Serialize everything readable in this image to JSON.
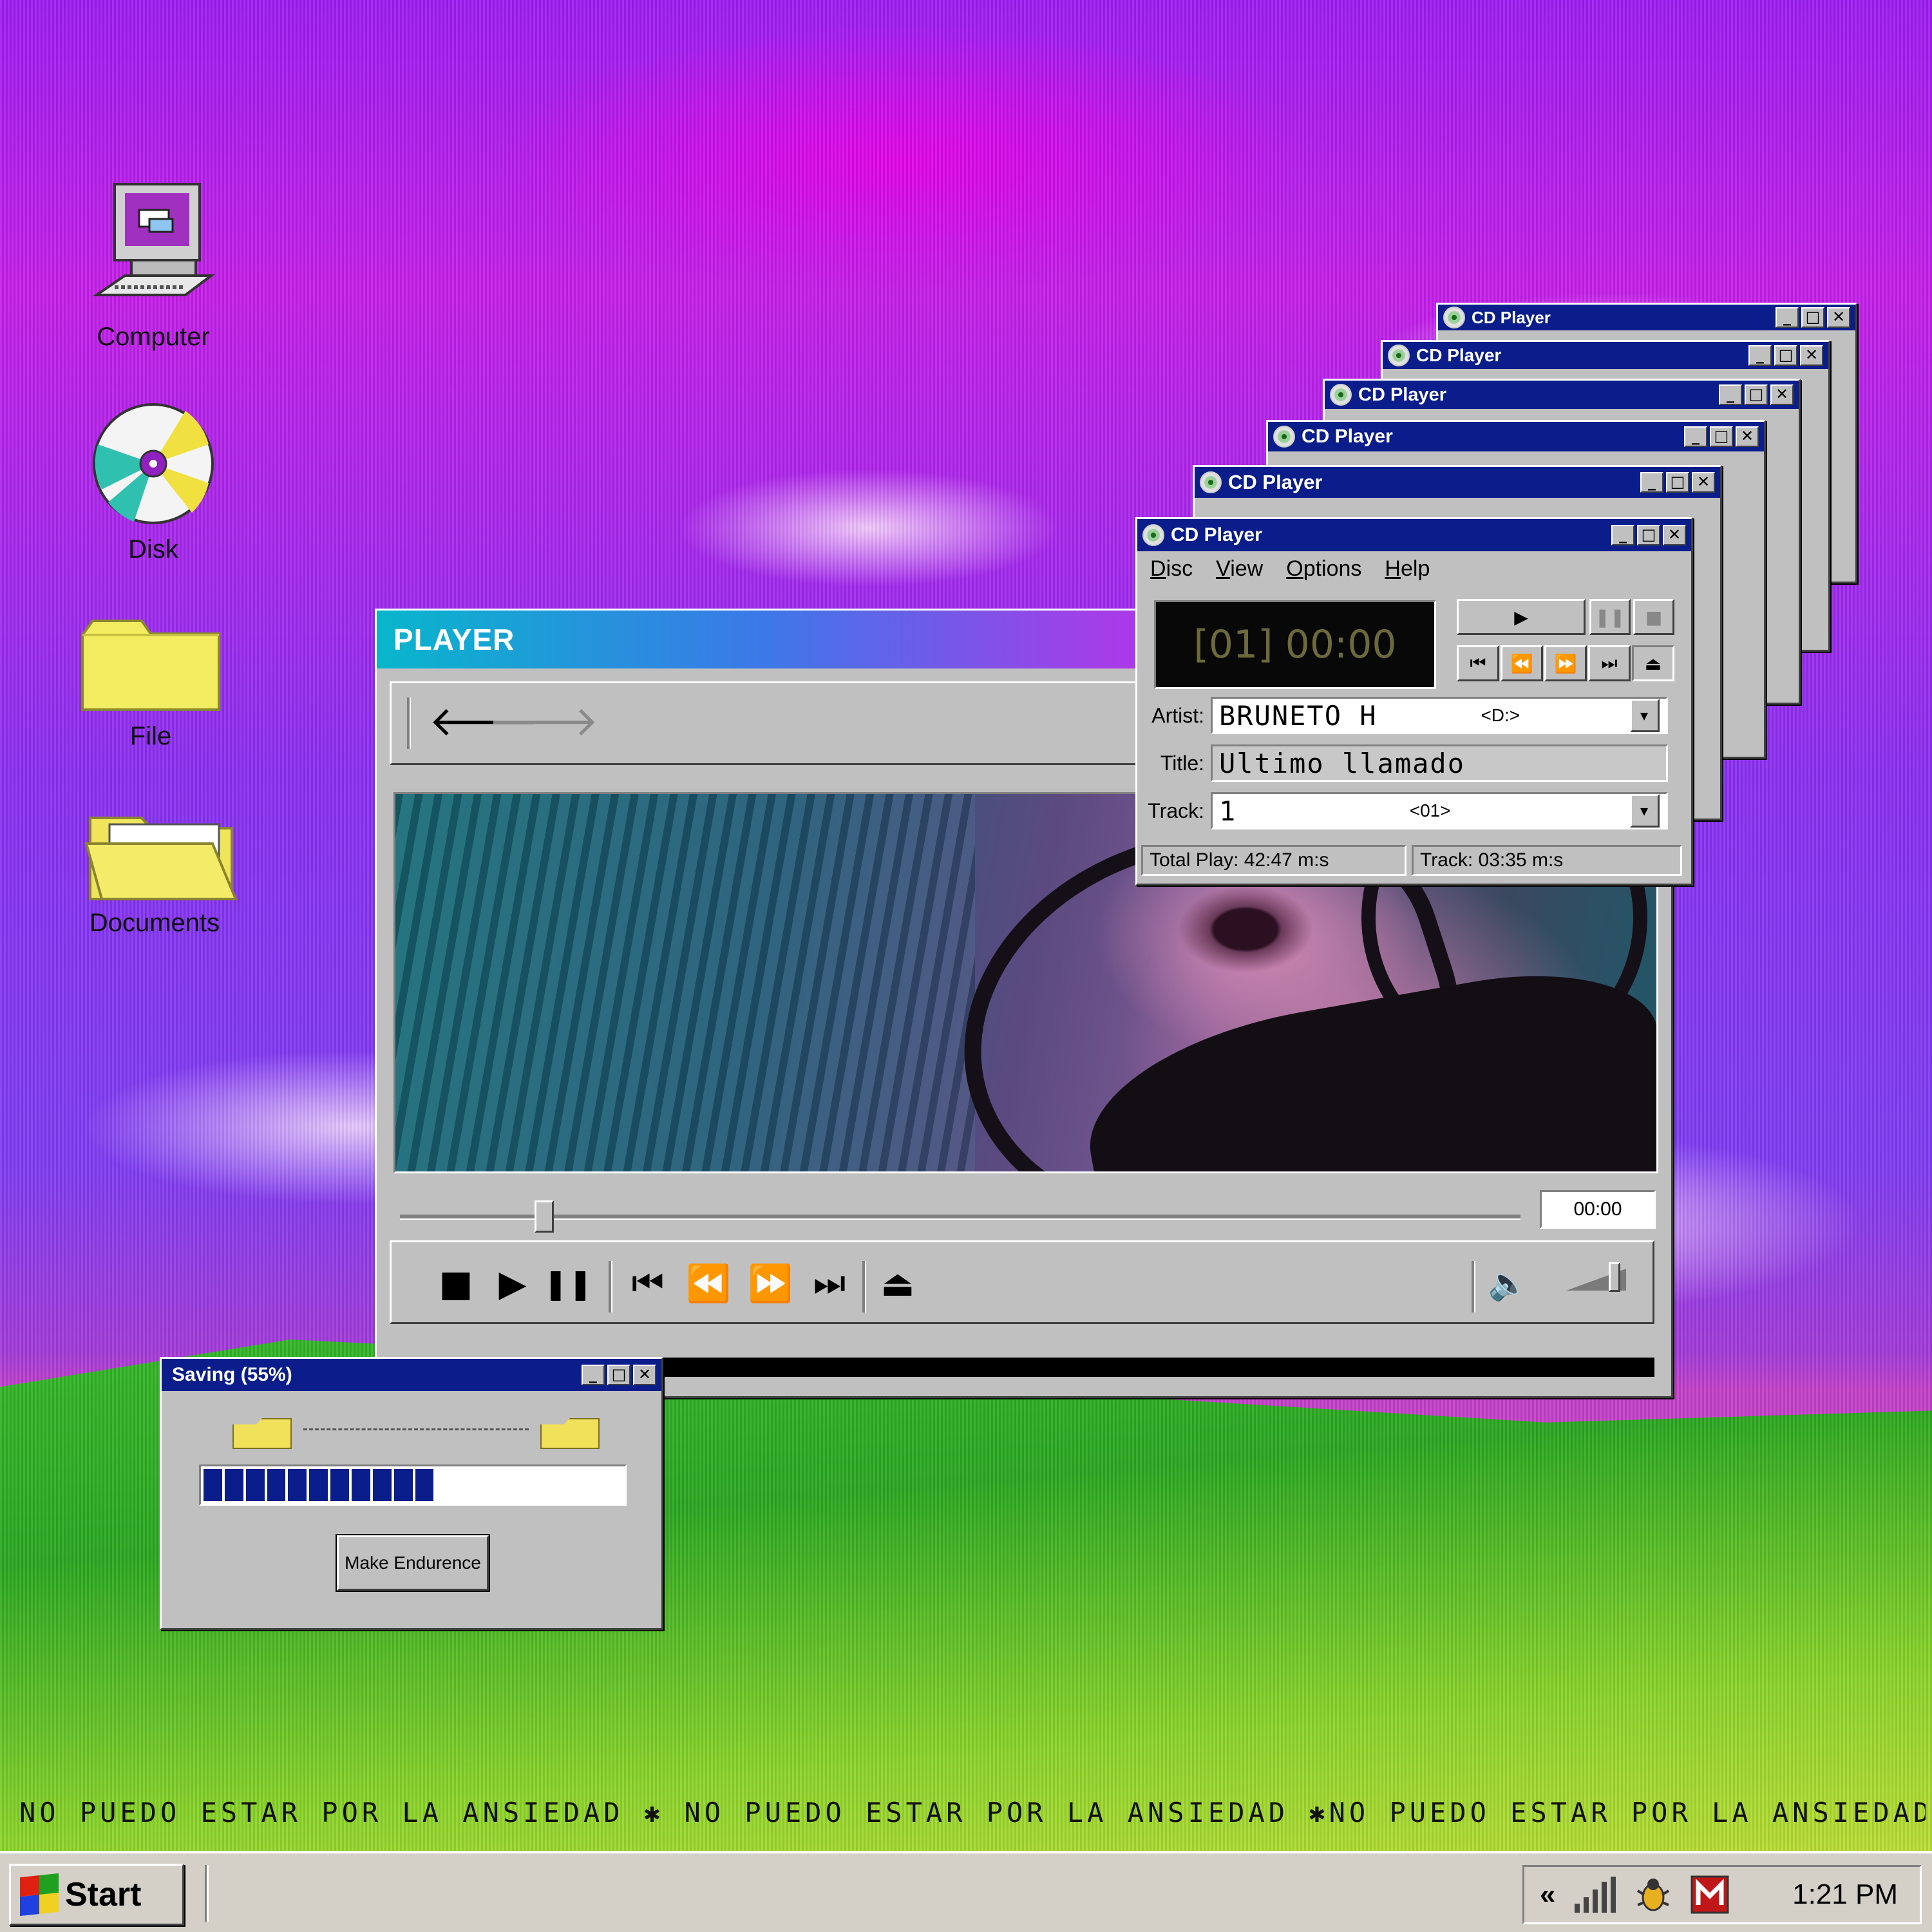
{
  "desktop": {
    "icons": [
      {
        "label": "Computer",
        "icon": "computer-icon"
      },
      {
        "label": "Disk",
        "icon": "cd-disk-icon"
      },
      {
        "label": "File",
        "icon": "folder-icon"
      },
      {
        "label": "Documents",
        "icon": "open-folder-icon"
      }
    ]
  },
  "cd_stack": {
    "titles": [
      "CD Player",
      "CD Player",
      "CD Player",
      "CD Player",
      "CD Player"
    ]
  },
  "cd_player": {
    "title": "CD Player",
    "menu": [
      "Disc",
      "View",
      "Options",
      "Help"
    ],
    "display": "[01] 00:00",
    "artist_label": "Artist:",
    "artist_value": "BRUNETO H",
    "artist_drive": "<D:>",
    "title_label": "Title:",
    "title_value": "Ultimo llamado",
    "track_label": "Track:",
    "track_value": "1",
    "track_code": "<01>",
    "total_play": "Total Play: 42:47 m:s",
    "track_time": "Track: 03:35 m:s",
    "buttons": {
      "play": "▶",
      "pause": "❚❚",
      "stop": "■",
      "first": "⏮",
      "rewind": "⏪",
      "forward": "⏩",
      "last": "⏭",
      "eject": "⏏"
    }
  },
  "player": {
    "title": "PLAYER",
    "back_icon": "🡐",
    "forward_icon": "🡒",
    "time": "00:00",
    "seek_fraction": 0.12,
    "volume_fraction": 0.75,
    "controls": {
      "stop": "■",
      "play": "▶",
      "pause": "❚❚",
      "prev": "⏮",
      "rewind": "⏪",
      "forward": "⏩",
      "next": "⏭",
      "eject": "⏏",
      "volume": "🔈"
    }
  },
  "saving": {
    "title": "Saving (55%)",
    "progress": 0.55,
    "button": "Make Endurence"
  },
  "marquee": "NO PUEDO ESTAR POR LA ANSIEDAD ✱ NO PUEDO ESTAR POR LA ANSIEDAD ✱NO PUEDO ESTAR POR LA ANSIEDAD ✱",
  "taskbar": {
    "start": "Start",
    "tray_arrows": "«",
    "clock": "1:21 PM"
  },
  "colors": {
    "titlebar": "#0a1d8a",
    "face": "#c0c0c0",
    "progress": "#0a1d8a"
  }
}
